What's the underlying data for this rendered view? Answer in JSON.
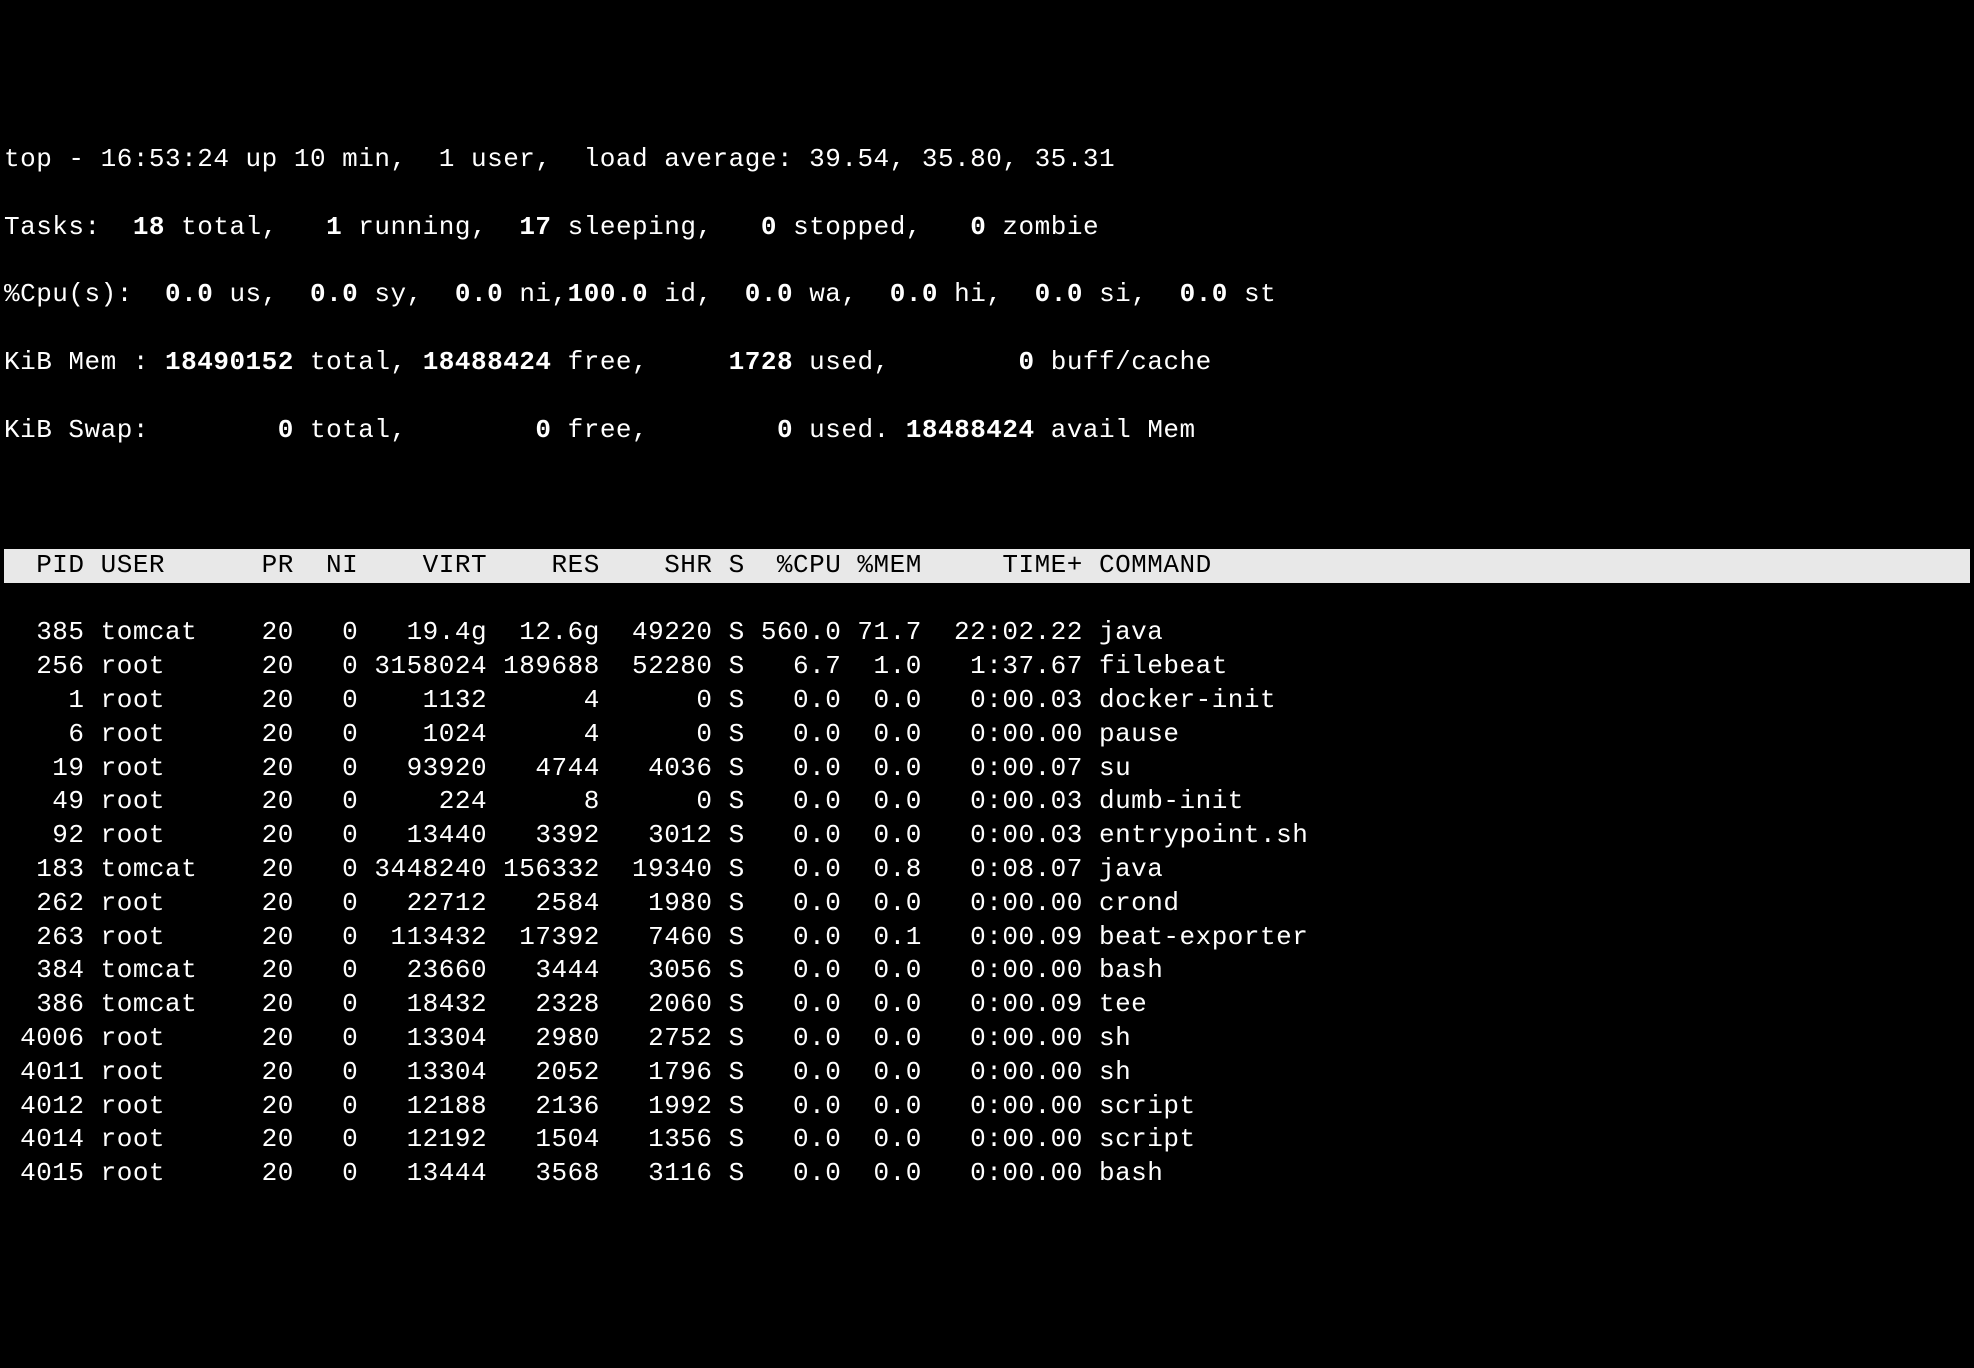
{
  "summary": {
    "line1_prefix": "top - ",
    "time": "16:53:24",
    "uptime": " up 10 min,  1 user,  load average: 39.54, 35.80, 35.31",
    "tasks_label": "Tasks: ",
    "tasks_total": " 18",
    "tasks_total_suffix": " total,   ",
    "tasks_running": "1",
    "tasks_running_suffix": " running,  ",
    "tasks_sleeping": "17",
    "tasks_sleeping_suffix": " sleeping,   ",
    "tasks_stopped": "0",
    "tasks_stopped_suffix": " stopped,   ",
    "tasks_zombie": "0",
    "tasks_zombie_suffix": " zombie",
    "cpu_label": "%Cpu(s):  ",
    "cpu_us": "0.0",
    "cpu_us_suffix": " us,  ",
    "cpu_sy": "0.0",
    "cpu_sy_suffix": " sy,  ",
    "cpu_ni": "0.0",
    "cpu_ni_suffix": " ni,",
    "cpu_id": "100.0",
    "cpu_id_suffix": " id,  ",
    "cpu_wa": "0.0",
    "cpu_wa_suffix": " wa,  ",
    "cpu_hi": "0.0",
    "cpu_hi_suffix": " hi,  ",
    "cpu_si": "0.0",
    "cpu_si_suffix": " si,  ",
    "cpu_st": "0.0",
    "cpu_st_suffix": " st",
    "mem_label": "KiB Mem : ",
    "mem_total": "18490152",
    "mem_total_suffix": " total, ",
    "mem_free": "18488424",
    "mem_free_suffix": " free,     ",
    "mem_used": "1728",
    "mem_used_suffix": " used,        ",
    "mem_buff": "0",
    "mem_buff_suffix": " buff/cache",
    "swap_label": "KiB Swap:        ",
    "swap_total": "0",
    "swap_total_suffix": " total,        ",
    "swap_free": "0",
    "swap_free_suffix": " free,        ",
    "swap_used": "0",
    "swap_used_suffix": " used. ",
    "swap_avail": "18488424",
    "swap_avail_suffix": " avail Mem"
  },
  "columns": "  PID USER      PR  NI    VIRT    RES    SHR S  %CPU %MEM     TIME+ COMMAND                                                 ",
  "processes": [
    {
      "row": "  385 tomcat    20   0   19.4g  12.6g  49220 S 560.0 71.7  22:02.22 java"
    },
    {
      "row": "  256 root      20   0 3158024 189688  52280 S   6.7  1.0   1:37.67 filebeat"
    },
    {
      "row": "    1 root      20   0    1132      4      0 S   0.0  0.0   0:00.03 docker-init"
    },
    {
      "row": "    6 root      20   0    1024      4      0 S   0.0  0.0   0:00.00 pause"
    },
    {
      "row": "   19 root      20   0   93920   4744   4036 S   0.0  0.0   0:00.07 su"
    },
    {
      "row": "   49 root      20   0     224      8      0 S   0.0  0.0   0:00.03 dumb-init"
    },
    {
      "row": "   92 root      20   0   13440   3392   3012 S   0.0  0.0   0:00.03 entrypoint.sh"
    },
    {
      "row": "  183 tomcat    20   0 3448240 156332  19340 S   0.0  0.8   0:08.07 java"
    },
    {
      "row": "  262 root      20   0   22712   2584   1980 S   0.0  0.0   0:00.00 crond"
    },
    {
      "row": "  263 root      20   0  113432  17392   7460 S   0.0  0.1   0:00.09 beat-exporter"
    },
    {
      "row": "  384 tomcat    20   0   23660   3444   3056 S   0.0  0.0   0:00.00 bash"
    },
    {
      "row": "  386 tomcat    20   0   18432   2328   2060 S   0.0  0.0   0:00.09 tee"
    },
    {
      "row": " 4006 root      20   0   13304   2980   2752 S   0.0  0.0   0:00.00 sh"
    },
    {
      "row": " 4011 root      20   0   13304   2052   1796 S   0.0  0.0   0:00.00 sh"
    },
    {
      "row": " 4012 root      20   0   12188   2136   1992 S   0.0  0.0   0:00.00 script"
    },
    {
      "row": " 4014 root      20   0   12192   1504   1356 S   0.0  0.0   0:00.00 script"
    },
    {
      "row": " 4015 root      20   0   13444   3568   3116 S   0.0  0.0   0:00.00 bash"
    }
  ]
}
